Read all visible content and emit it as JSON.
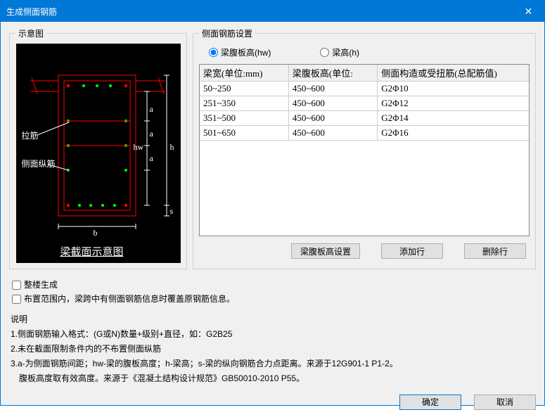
{
  "window": {
    "title": "生成侧面钢筋"
  },
  "box_left": {
    "title": "示意图"
  },
  "box_right": {
    "title": "侧面钢筋设置"
  },
  "radio": {
    "opt_hw": "梁腹板高(hw)",
    "opt_h": "梁高(h)"
  },
  "table": {
    "headers": {
      "col1": "梁宽(单位:mm)",
      "col2": "梁腹板高(单位:",
      "col3": "侧面构造或受扭筋(总配筋值)"
    },
    "rows": [
      {
        "c1": "50~250",
        "c2": "450~600",
        "c3": "G2Φ10"
      },
      {
        "c1": "251~350",
        "c2": "450~600",
        "c3": "G2Φ12"
      },
      {
        "c1": "351~500",
        "c2": "450~600",
        "c3": "G2Φ14"
      },
      {
        "c1": "501~650",
        "c2": "450~600",
        "c3": "G2Φ16"
      }
    ]
  },
  "buttons": {
    "hw_setting": "梁腹板高设置",
    "add_row": "添加行",
    "del_row": "删除行",
    "ok": "确定",
    "cancel": "取消"
  },
  "checks": {
    "whole_building": "整楼生成",
    "overwrite": "布置范围内，梁跨中有侧面钢筋信息时覆盖原钢筋信息。"
  },
  "help": {
    "title": "说明",
    "l1": "1.侧面钢筋输入格式：(G或N)数量+级别+直径，如：G2B25",
    "l2": "2.未在截面限制条件内的不布置侧面纵筋",
    "l3": "3.a-为侧面钢筋间距；hw-梁的腹板高度；h-梁高；s-梁的纵向钢筋合力点距离。来源于12G901-1 P1-2。",
    "l4": "　腹板高度取有效高度。来源于《混凝土结构设计规范》GB50010-2010 P55。"
  },
  "cad": {
    "lajin": "拉筋",
    "zongjin": "侧面纵筋",
    "caption": "梁截面示意图",
    "b": "b",
    "h": "h",
    "hw": "hw",
    "a": "a",
    "s": "s"
  }
}
